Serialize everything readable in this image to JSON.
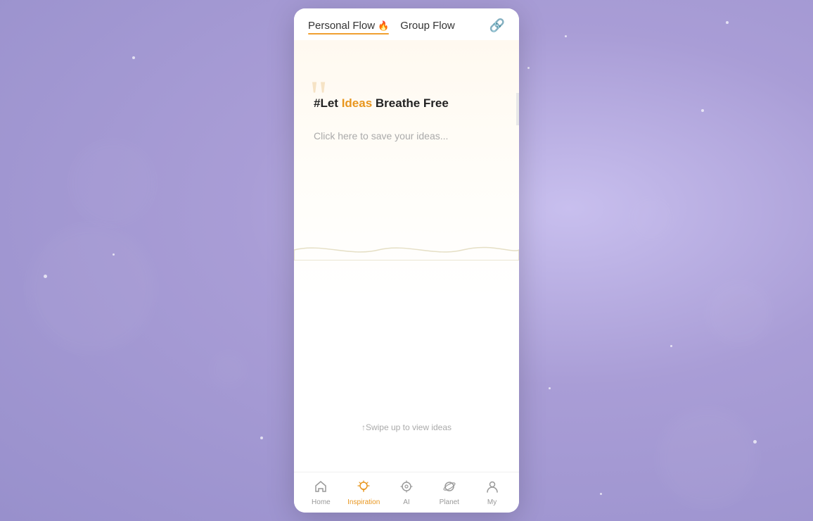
{
  "background": {
    "color": "#b0a8d8"
  },
  "modal": {
    "close_label": "×"
  },
  "tabs": [
    {
      "id": "personal",
      "label": "Personal Flow",
      "emoji": "🔥",
      "active": true
    },
    {
      "id": "group",
      "label": "Group Flow",
      "active": false
    }
  ],
  "link_icon": "🔗",
  "content": {
    "quote_mark": "❝",
    "tagline_prefix": "#Let ",
    "tagline_highlight": "Ideas",
    "tagline_suffix": " Breathe Free",
    "placeholder": "Click here to save your ideas..."
  },
  "swipe_hint": "↑Swipe up to view ideas",
  "bottom_nav": [
    {
      "id": "home",
      "label": "Home",
      "icon": "⌂",
      "active": false
    },
    {
      "id": "inspiration",
      "label": "Inspiration",
      "icon": "💡",
      "active": true
    },
    {
      "id": "ai",
      "label": "AI",
      "icon": "◎",
      "active": false
    },
    {
      "id": "planet",
      "label": "Planet",
      "icon": "◯",
      "active": false
    },
    {
      "id": "my",
      "label": "My",
      "icon": "☻",
      "active": false
    }
  ],
  "arrow": "▶"
}
